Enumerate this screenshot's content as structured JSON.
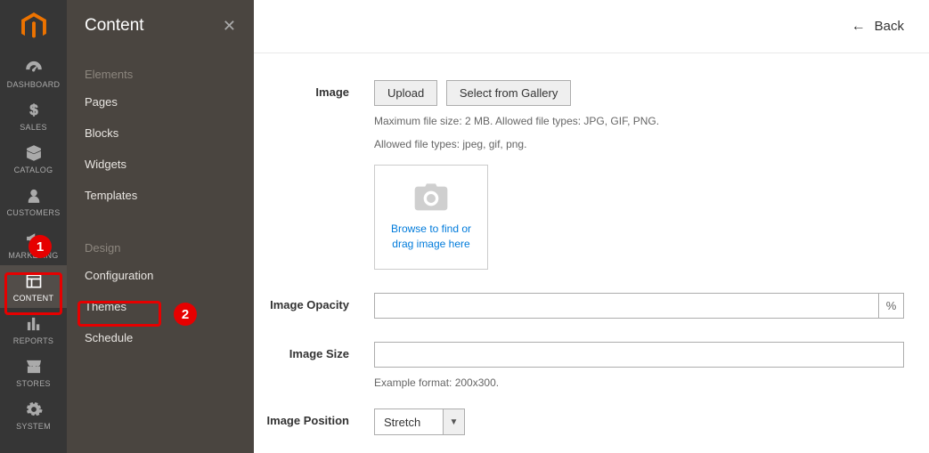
{
  "rail": {
    "items": [
      {
        "name": "dashboard",
        "label": "DASHBOARD"
      },
      {
        "name": "sales",
        "label": "SALES"
      },
      {
        "name": "catalog",
        "label": "CATALOG"
      },
      {
        "name": "customers",
        "label": "CUSTOMERS"
      },
      {
        "name": "marketing",
        "label": "MARKETING"
      },
      {
        "name": "content",
        "label": "CONTENT"
      },
      {
        "name": "reports",
        "label": "REPORTS"
      },
      {
        "name": "stores",
        "label": "STORES"
      },
      {
        "name": "system",
        "label": "SYSTEM"
      }
    ]
  },
  "callouts": {
    "one": "1",
    "two": "2"
  },
  "panel": {
    "title": "Content",
    "groups": [
      {
        "title": "Elements",
        "items": [
          {
            "label": "Pages"
          },
          {
            "label": "Blocks"
          },
          {
            "label": "Widgets"
          },
          {
            "label": "Templates"
          }
        ]
      },
      {
        "title": "Design",
        "items": [
          {
            "label": "Configuration"
          },
          {
            "label": "Themes"
          },
          {
            "label": "Schedule"
          }
        ]
      }
    ]
  },
  "topbar": {
    "back": "Back"
  },
  "form": {
    "image": {
      "label": "Image",
      "upload": "Upload",
      "gallery": "Select from Gallery",
      "hint1": "Maximum file size: 2 MB. Allowed file types: JPG, GIF, PNG.",
      "hint2": "Allowed file types: jpeg, gif, png.",
      "dropzone": "Browse to find or drag image here"
    },
    "opacity": {
      "label": "Image Opacity",
      "value": "",
      "suffix": "%"
    },
    "size": {
      "label": "Image Size",
      "value": "",
      "hint": "Example format: 200x300."
    },
    "position": {
      "label": "Image Position",
      "value": "Stretch"
    }
  }
}
